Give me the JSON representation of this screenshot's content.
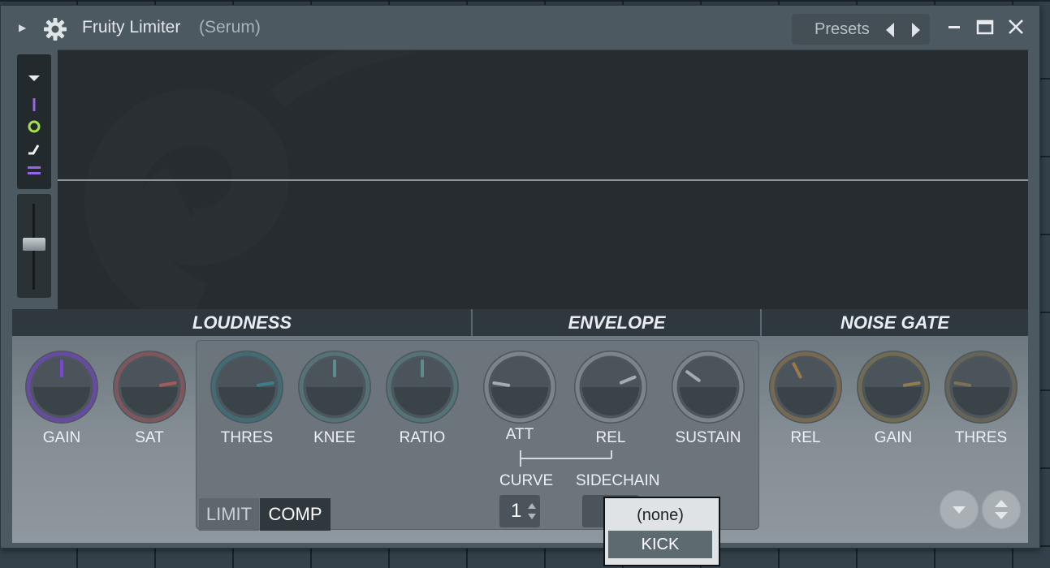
{
  "window": {
    "title": "Fruity Limiter",
    "subtitle": "(Serum)",
    "presets_label": "Presets"
  },
  "sections": {
    "loudness": "LOUDNESS",
    "envelope": "ENVELOPE",
    "noise_gate": "NOISE GATE"
  },
  "knobs": {
    "gain": {
      "label": "GAIN",
      "value": 0.5,
      "color": "#7c44d8"
    },
    "sat": {
      "label": "SAT",
      "value": 0.8,
      "color": "#a5595b"
    },
    "thres": {
      "label": "THRES",
      "value": 0.8,
      "color": "#3a7e88"
    },
    "knee": {
      "label": "KNEE",
      "value": 0.5,
      "color": "#5d8c8a"
    },
    "ratio": {
      "label": "RATIO",
      "value": 0.5,
      "color": "#5d8c8a"
    },
    "att": {
      "label": "ATT",
      "value": 0.2,
      "color": "#a3acb1"
    },
    "rel": {
      "label": "REL",
      "value": 0.75,
      "color": "#a3acb1"
    },
    "sustain": {
      "label": "SUSTAIN",
      "value": 0.3,
      "color": "#a3acb1"
    },
    "gate_rel": {
      "label": "REL",
      "value": 0.4,
      "color": "#9b7a49"
    },
    "gate_gain": {
      "label": "GAIN",
      "value": 0.8,
      "color": "#8f7d4f"
    },
    "gate_thres": {
      "label": "THRES",
      "value": 0.2,
      "color": "#7c7155"
    }
  },
  "curve": {
    "label": "CURVE",
    "value": "1"
  },
  "sidechain": {
    "label": "SIDECHAIN",
    "options": [
      "(none)",
      "KICK"
    ],
    "selected": "KICK"
  },
  "modes": {
    "limit": "LIMIT",
    "comp": "COMP",
    "active": "COMP"
  },
  "icons": {
    "expand": "triangle-right-icon",
    "settings": "gear-icon",
    "prev": "arrow-left-icon",
    "next": "arrow-right-icon",
    "minimize": "minimize-icon",
    "maximize": "maximize-icon",
    "close": "close-icon"
  }
}
